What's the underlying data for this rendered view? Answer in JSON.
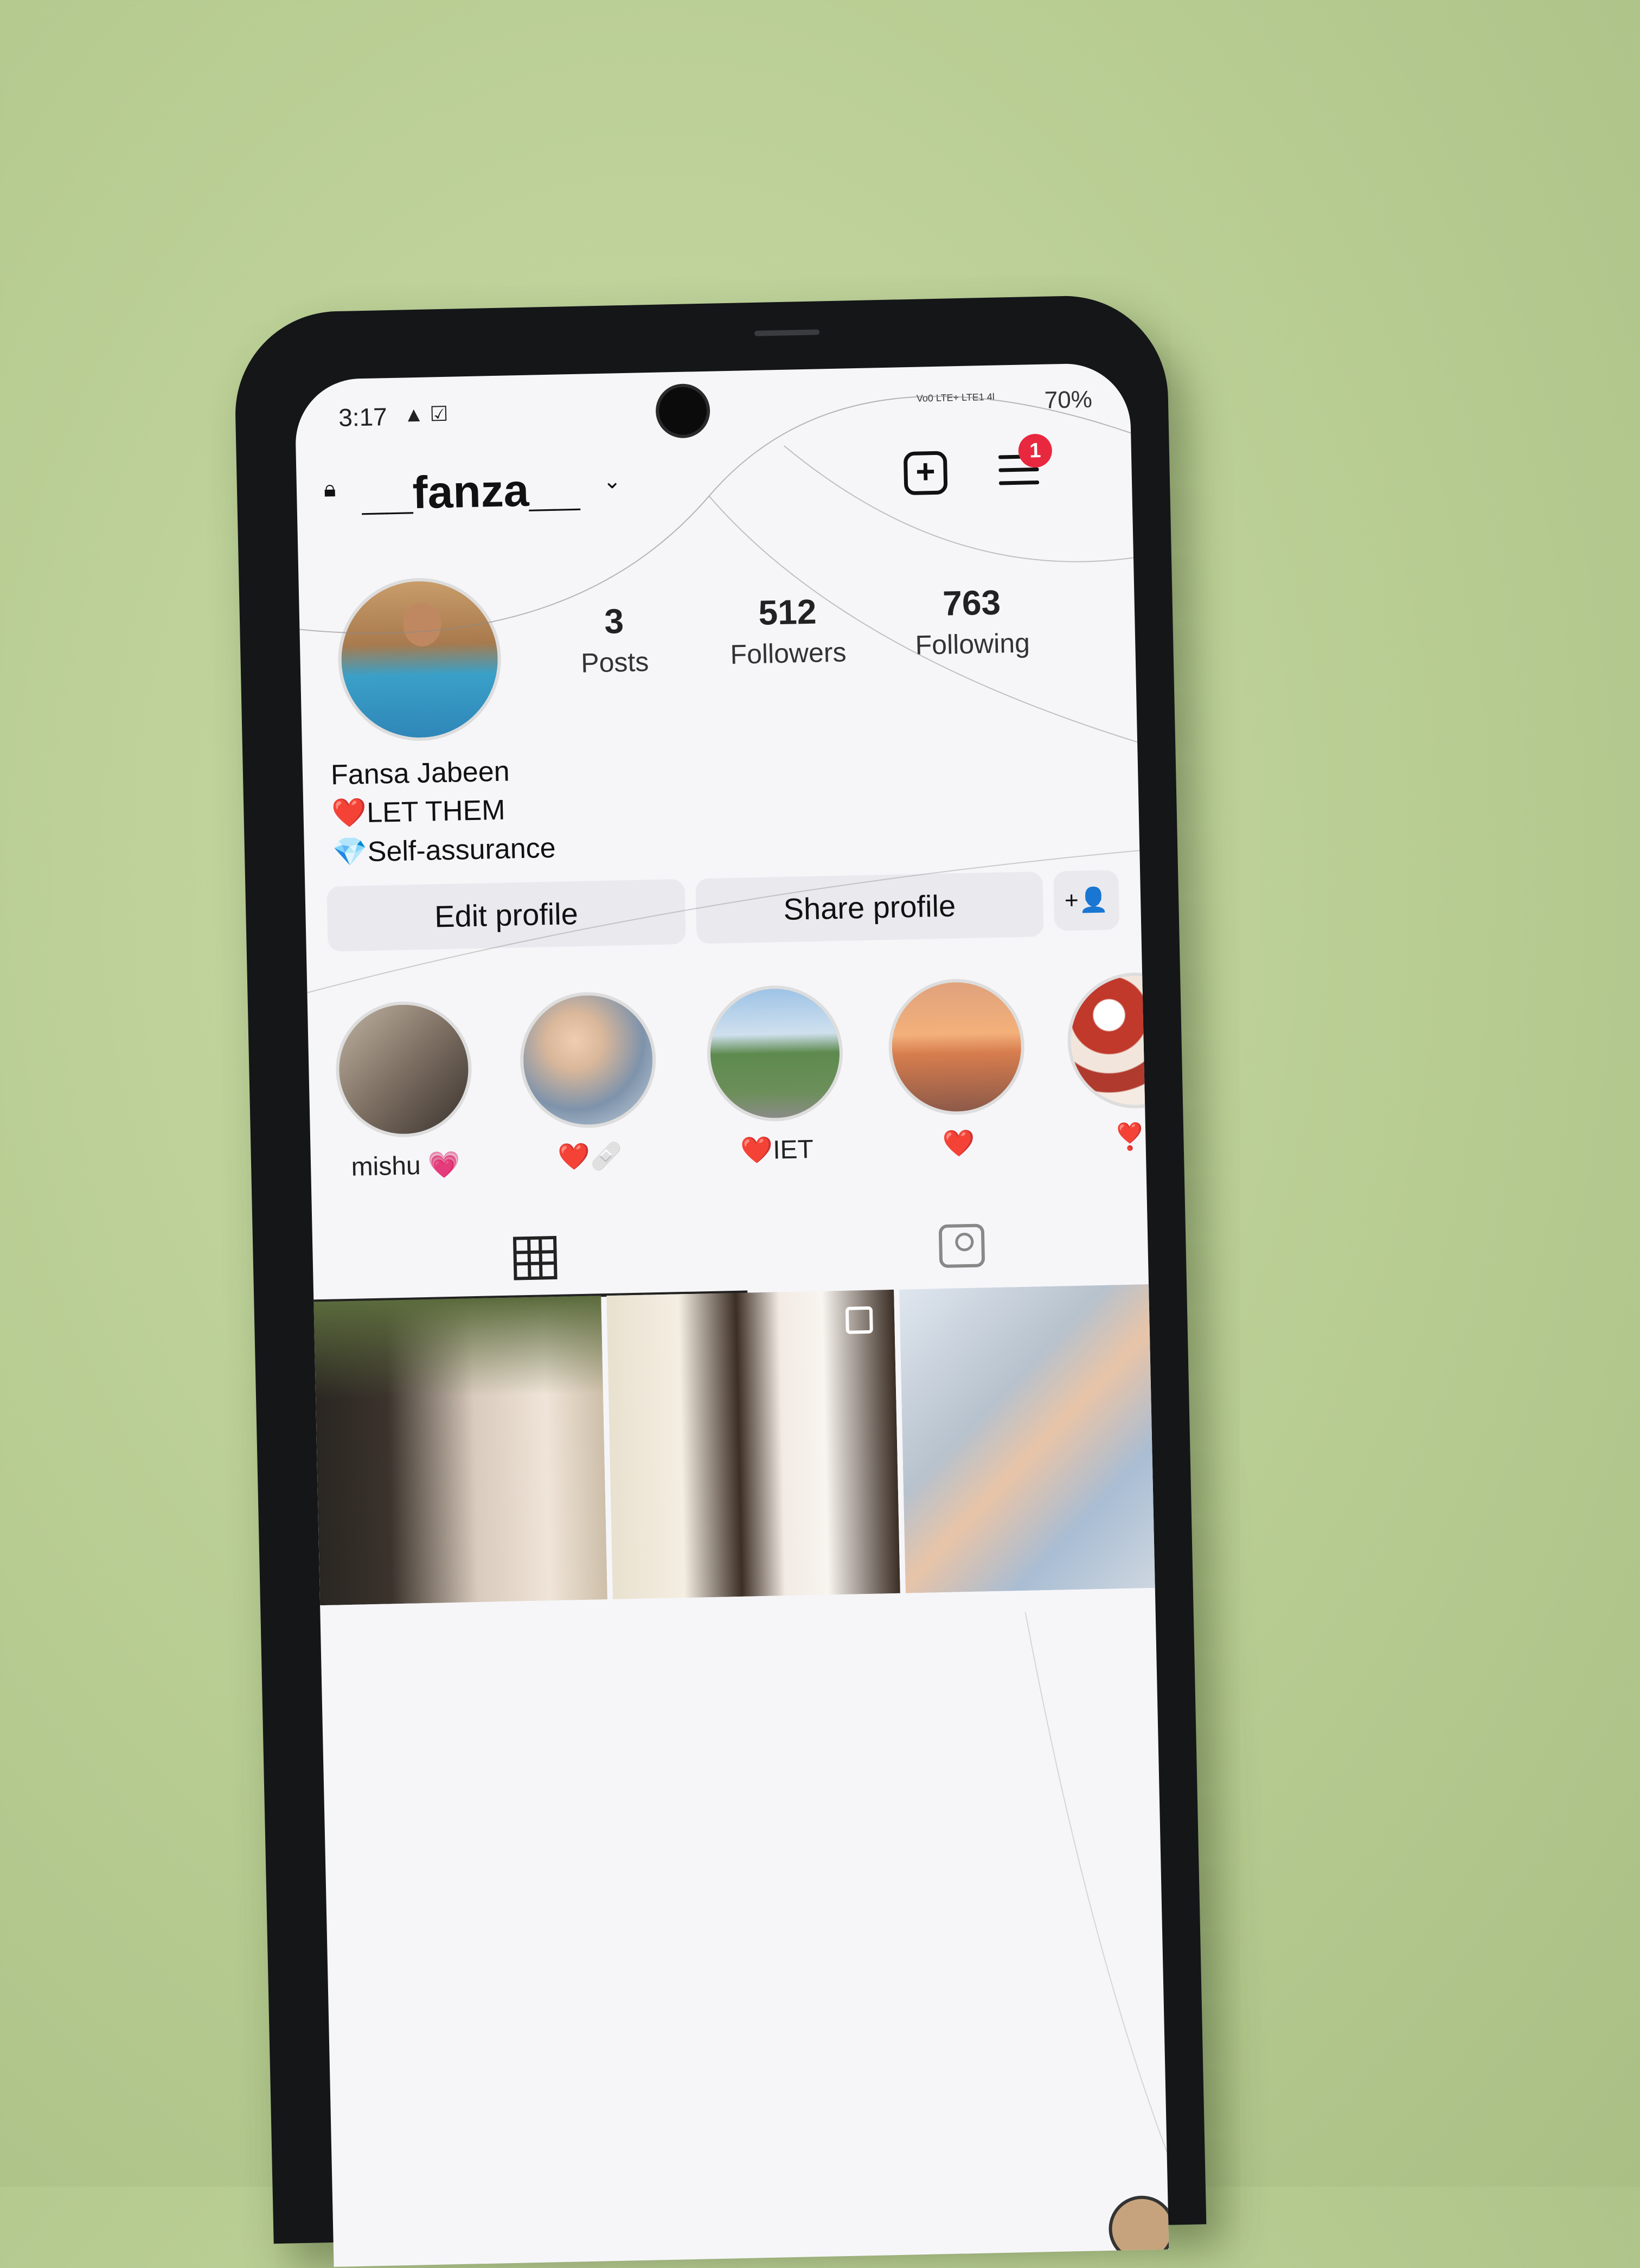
{
  "status_bar": {
    "time": "3:17",
    "icons": "▲ ☑",
    "network": "Vo0 LTE+ LTE1 4l",
    "battery": "70%"
  },
  "header": {
    "username": "__fanza__",
    "notification_count": "1"
  },
  "profile": {
    "stats": [
      {
        "value": "3",
        "label": "Posts"
      },
      {
        "value": "512",
        "label": "Followers"
      },
      {
        "value": "763",
        "label": "Following"
      }
    ],
    "name": "Fansa Jabeen",
    "bio_line1": "❤️LET THEM",
    "bio_line2": "💎Self-assurance"
  },
  "buttons": {
    "edit": "Edit profile",
    "share": "Share profile",
    "add_person": "+👤"
  },
  "highlights": [
    {
      "label": "mishu 💗"
    },
    {
      "label": "❤️🩹"
    },
    {
      "label": "❤️IET"
    },
    {
      "label": "❤️"
    },
    {
      "label": "❣️+"
    }
  ],
  "colors": {
    "badge": "#e8283f",
    "button_bg": "#e9e9ee",
    "screen_bg": "#f6f6f9"
  }
}
